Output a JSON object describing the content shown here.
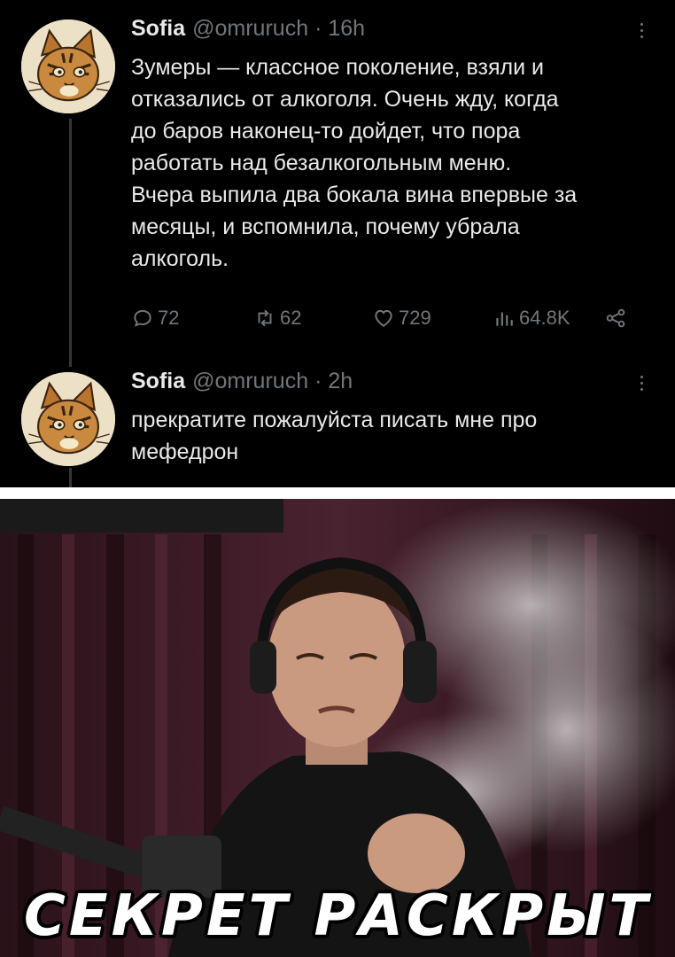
{
  "tweets": [
    {
      "display_name": "Sofia",
      "handle": "@omruruch",
      "separator": "·",
      "time": "16h",
      "lines": [
        "Зумеры — классное поколение, взяли и",
        "отказались от алкоголя. Очень жду, когда",
        "до баров наконец-то дойдет, что пора",
        "работать над безалкогольным меню.",
        "Вчера выпила два бокала вина впервые за",
        "месяцы, и вспомнила, почему убрала",
        "алкоголь."
      ],
      "stats": {
        "replies": "72",
        "retweets": "62",
        "likes": "729",
        "views": "64.8K"
      }
    },
    {
      "display_name": "Sofia",
      "handle": "@omruruch",
      "separator": "·",
      "time": "2h",
      "lines": [
        "прекратите пожалуйста писать мне про",
        "мефедрон"
      ]
    }
  ],
  "meme": {
    "caption": "СЕКРЕТ РАСКРЫТ"
  },
  "colors": {
    "background": "#000000",
    "text": "#e7e9ea",
    "muted": "#71767b",
    "divider": "#ffffff"
  },
  "icons": [
    "more-options-icon",
    "reply-icon",
    "retweet-icon",
    "like-icon",
    "views-icon",
    "share-icon",
    "cat-avatar-icon"
  ]
}
